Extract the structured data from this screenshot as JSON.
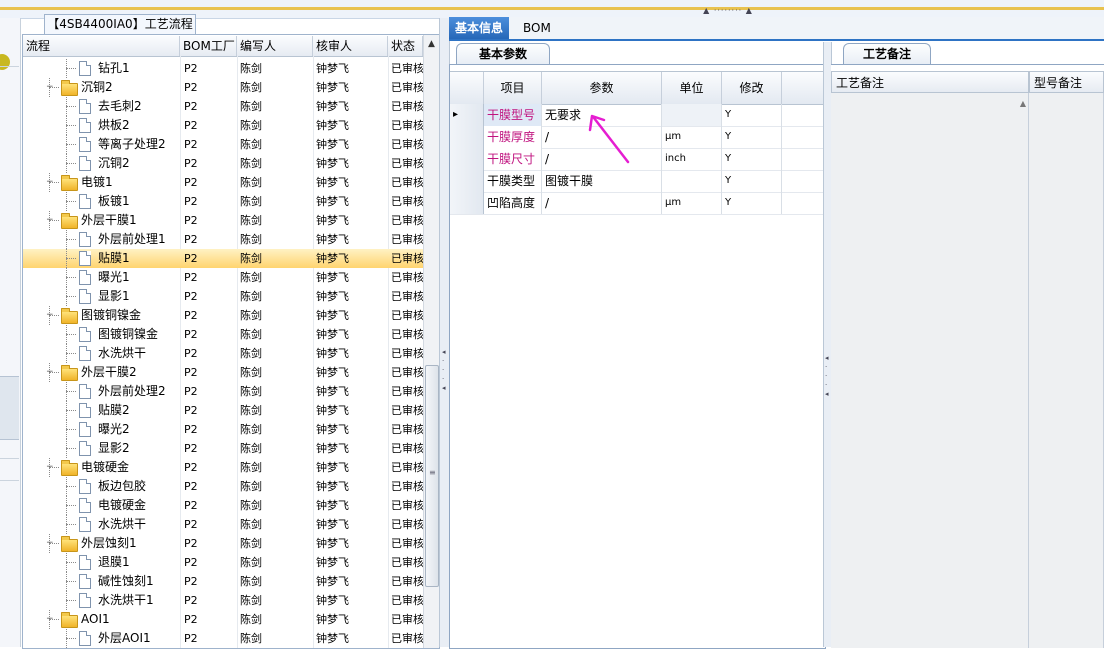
{
  "topbar": {
    "grip": "▲ ········ ▲"
  },
  "process": {
    "tab_title": "【4SB4400IA0】工艺流程",
    "columns": [
      "流程",
      "BOM工厂",
      "编写人",
      "核审人",
      "状态"
    ],
    "rows": [
      {
        "name": "钻孔1",
        "level": 1,
        "type": "doc",
        "plant": "P2",
        "writer": "陈剑",
        "reviewer": "钟梦飞",
        "status": "已审核"
      },
      {
        "name": "沉铜2",
        "level": 0,
        "type": "folder",
        "plant": "P2",
        "writer": "陈剑",
        "reviewer": "钟梦飞",
        "status": "已审核"
      },
      {
        "name": "去毛刺2",
        "level": 1,
        "type": "doc",
        "plant": "P2",
        "writer": "陈剑",
        "reviewer": "钟梦飞",
        "status": "已审核"
      },
      {
        "name": "烘板2",
        "level": 1,
        "type": "doc",
        "plant": "P2",
        "writer": "陈剑",
        "reviewer": "钟梦飞",
        "status": "已审核"
      },
      {
        "name": "等离子处理2",
        "level": 1,
        "type": "doc",
        "plant": "P2",
        "writer": "陈剑",
        "reviewer": "钟梦飞",
        "status": "已审核"
      },
      {
        "name": "沉铜2",
        "level": 1,
        "type": "doc",
        "plant": "P2",
        "writer": "陈剑",
        "reviewer": "钟梦飞",
        "status": "已审核"
      },
      {
        "name": "电镀1",
        "level": 0,
        "type": "folder",
        "plant": "P2",
        "writer": "陈剑",
        "reviewer": "钟梦飞",
        "status": "已审核"
      },
      {
        "name": "板镀1",
        "level": 1,
        "type": "doc",
        "plant": "P2",
        "writer": "陈剑",
        "reviewer": "钟梦飞",
        "status": "已审核"
      },
      {
        "name": "外层干膜1",
        "level": 0,
        "type": "folder",
        "plant": "P2",
        "writer": "陈剑",
        "reviewer": "钟梦飞",
        "status": "已审核"
      },
      {
        "name": "外层前处理1",
        "level": 1,
        "type": "doc",
        "plant": "P2",
        "writer": "陈剑",
        "reviewer": "钟梦飞",
        "status": "已审核"
      },
      {
        "name": "贴膜1",
        "level": 1,
        "type": "doc",
        "plant": "P2",
        "writer": "陈剑",
        "reviewer": "钟梦飞",
        "status": "已审核",
        "selected": true
      },
      {
        "name": "曝光1",
        "level": 1,
        "type": "doc",
        "plant": "P2",
        "writer": "陈剑",
        "reviewer": "钟梦飞",
        "status": "已审核"
      },
      {
        "name": "显影1",
        "level": 1,
        "type": "doc",
        "plant": "P2",
        "writer": "陈剑",
        "reviewer": "钟梦飞",
        "status": "已审核"
      },
      {
        "name": "图镀铜镍金",
        "level": 0,
        "type": "folder",
        "plant": "P2",
        "writer": "陈剑",
        "reviewer": "钟梦飞",
        "status": "已审核"
      },
      {
        "name": "图镀铜镍金",
        "level": 1,
        "type": "doc",
        "plant": "P2",
        "writer": "陈剑",
        "reviewer": "钟梦飞",
        "status": "已审核"
      },
      {
        "name": "水洗烘干",
        "level": 1,
        "type": "doc",
        "plant": "P2",
        "writer": "陈剑",
        "reviewer": "钟梦飞",
        "status": "已审核"
      },
      {
        "name": "外层干膜2",
        "level": 0,
        "type": "folder",
        "plant": "P2",
        "writer": "陈剑",
        "reviewer": "钟梦飞",
        "status": "已审核"
      },
      {
        "name": "外层前处理2",
        "level": 1,
        "type": "doc",
        "plant": "P2",
        "writer": "陈剑",
        "reviewer": "钟梦飞",
        "status": "已审核"
      },
      {
        "name": "贴膜2",
        "level": 1,
        "type": "doc",
        "plant": "P2",
        "writer": "陈剑",
        "reviewer": "钟梦飞",
        "status": "已审核"
      },
      {
        "name": "曝光2",
        "level": 1,
        "type": "doc",
        "plant": "P2",
        "writer": "陈剑",
        "reviewer": "钟梦飞",
        "status": "已审核"
      },
      {
        "name": "显影2",
        "level": 1,
        "type": "doc",
        "plant": "P2",
        "writer": "陈剑",
        "reviewer": "钟梦飞",
        "status": "已审核"
      },
      {
        "name": "电镀硬金",
        "level": 0,
        "type": "folder",
        "plant": "P2",
        "writer": "陈剑",
        "reviewer": "钟梦飞",
        "status": "已审核"
      },
      {
        "name": "板边包胶",
        "level": 1,
        "type": "doc",
        "plant": "P2",
        "writer": "陈剑",
        "reviewer": "钟梦飞",
        "status": "已审核"
      },
      {
        "name": "电镀硬金",
        "level": 1,
        "type": "doc",
        "plant": "P2",
        "writer": "陈剑",
        "reviewer": "钟梦飞",
        "status": "已审核"
      },
      {
        "name": "水洗烘干",
        "level": 1,
        "type": "doc",
        "plant": "P2",
        "writer": "陈剑",
        "reviewer": "钟梦飞",
        "status": "已审核"
      },
      {
        "name": "外层蚀刻1",
        "level": 0,
        "type": "folder",
        "plant": "P2",
        "writer": "陈剑",
        "reviewer": "钟梦飞",
        "status": "已审核"
      },
      {
        "name": "退膜1",
        "level": 1,
        "type": "doc",
        "plant": "P2",
        "writer": "陈剑",
        "reviewer": "钟梦飞",
        "status": "已审核"
      },
      {
        "name": "碱性蚀刻1",
        "level": 1,
        "type": "doc",
        "plant": "P2",
        "writer": "陈剑",
        "reviewer": "钟梦飞",
        "status": "已审核"
      },
      {
        "name": "水洗烘干1",
        "level": 1,
        "type": "doc",
        "plant": "P2",
        "writer": "陈剑",
        "reviewer": "钟梦飞",
        "status": "已审核"
      },
      {
        "name": "AOI1",
        "level": 0,
        "type": "folder",
        "plant": "P2",
        "writer": "陈剑",
        "reviewer": "钟梦飞",
        "status": "已审核"
      },
      {
        "name": "外层AOI1",
        "level": 1,
        "type": "doc",
        "plant": "P2",
        "writer": "陈剑",
        "reviewer": "钟梦飞",
        "status": "已审核"
      }
    ]
  },
  "tabs": {
    "basic_info": "基本信息",
    "bom": "BOM"
  },
  "params": {
    "subtab": "基本参数",
    "columns": [
      "项目",
      "参数",
      "单位",
      "修改"
    ],
    "row_marker": "▸",
    "rows": [
      {
        "item": "干膜型号",
        "param": "无要求",
        "unit": "",
        "modify": "Y",
        "highlight": true,
        "current": true
      },
      {
        "item": "干膜厚度",
        "param": "/",
        "unit": "μm",
        "modify": "Y",
        "highlight": true
      },
      {
        "item": "干膜尺寸",
        "param": "/",
        "unit": "inch",
        "modify": "Y",
        "highlight": true
      },
      {
        "item": "干膜类型",
        "param": "图镀干膜",
        "unit": "",
        "modify": "Y",
        "highlight": false
      },
      {
        "item": "凹陷高度",
        "param": "/",
        "unit": "μm",
        "modify": "Y",
        "highlight": false
      }
    ]
  },
  "notes": {
    "tab": "工艺备注",
    "col_process": "工艺备注",
    "col_model": "型号备注"
  },
  "colors": {
    "accent": "#2e73c4",
    "pink": "#c0137f",
    "selected_row": "#ffd46f",
    "arrow": "#e51dd1"
  }
}
